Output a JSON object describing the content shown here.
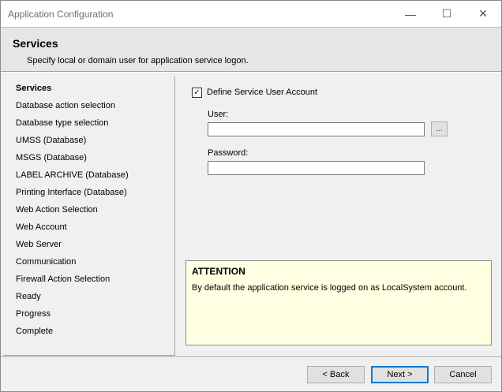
{
  "window": {
    "title": "Application Configuration",
    "minimize_glyph": "—",
    "maximize_glyph": "☐",
    "close_glyph": "✕"
  },
  "header": {
    "title": "Services",
    "subtitle": "Specify local or domain user for application service logon."
  },
  "nav": {
    "active_index": 0,
    "items": [
      "Services",
      "Database action selection",
      "Database type selection",
      "UMSS (Database)",
      "MSGS (Database)",
      "LABEL ARCHIVE (Database)",
      "Printing Interface (Database)",
      "Web Action Selection",
      "Web Account",
      "Web Server",
      "Communication",
      "Firewall Action Selection",
      "Ready",
      "Progress",
      "Complete"
    ]
  },
  "form": {
    "define_user": {
      "label": "Define Service User Account",
      "checked": true,
      "check_glyph": "✓"
    },
    "user": {
      "label": "User:",
      "value": "",
      "browse_label": "..."
    },
    "password": {
      "label": "Password:",
      "value": ""
    }
  },
  "attention": {
    "title": "ATTENTION",
    "text": "By default the application service is logged on as LocalSystem account."
  },
  "buttons": {
    "back": "< Back",
    "next": "Next >",
    "cancel": "Cancel"
  },
  "colors": {
    "attention_bg": "#ffffe1",
    "default_button_border": "#0078d7"
  }
}
